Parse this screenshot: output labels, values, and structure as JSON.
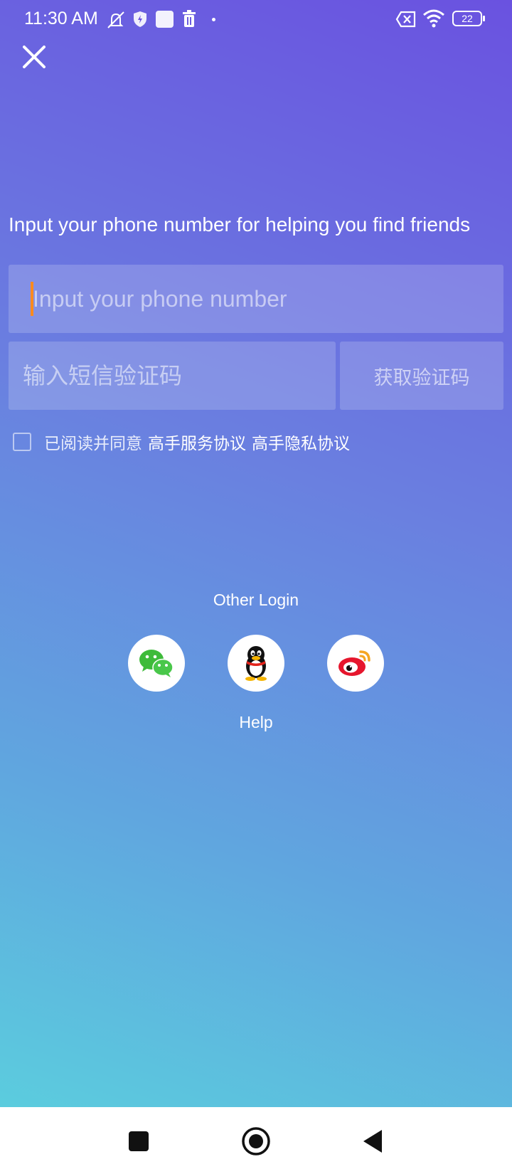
{
  "status_bar": {
    "time": "11:30 AM",
    "battery": "22",
    "icons": [
      "mute-icon",
      "shield-icon",
      "square-notification-icon",
      "trash-icon",
      "dot-icon",
      "no-sim-icon",
      "wifi-icon",
      "battery-icon"
    ]
  },
  "login": {
    "prompt": "Input your phone number for helping you find friends",
    "phone_placeholder": "Input your phone number",
    "code_placeholder": "输入短信验证码",
    "get_code_label": "获取验证码",
    "agree_text": "已阅读并同意",
    "service_agreement": "高手服务协议",
    "privacy_agreement": "高手隐私协议",
    "caret_color": "#ff8a1e"
  },
  "other_login": {
    "title": "Other Login",
    "providers": [
      "wechat-icon",
      "qq-icon",
      "weibo-icon"
    ],
    "help_label": "Help"
  },
  "nav": {
    "buttons": [
      "recents-button",
      "home-button",
      "back-button"
    ]
  }
}
